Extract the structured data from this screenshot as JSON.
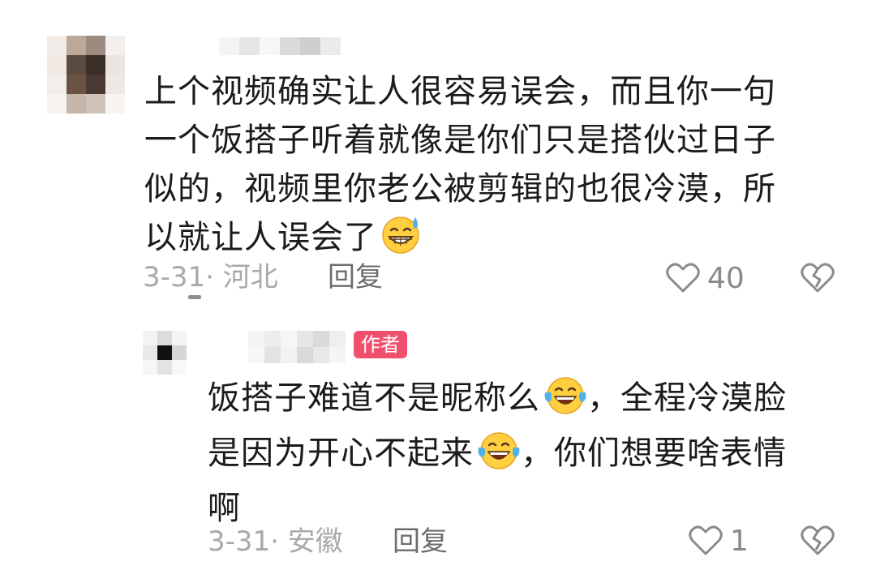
{
  "comments": [
    {
      "text_lines": [
        "上个视频确实让人很容易误会，而且你一句",
        "一个饭搭子听着就像是你们只是搭伙过日子",
        "似的，视频里你老公被剪辑的也很冷漠，所",
        "以就让人误会了"
      ],
      "emoji": "grin-sweat-emoji",
      "date": "3-31",
      "location": "· 河北",
      "reply_label": "回复",
      "like_count": "40",
      "reply": {
        "author_badge": "作者",
        "text_lines": [
          "饭搭子难道不是昵称么",
          "，全程冷漠脸",
          "是因为开心不起来",
          "，你们想要啥表情",
          "啊"
        ],
        "emoji": "tears-of-joy-emoji",
        "date": "3-31",
        "location": "· 安徽",
        "reply_label": "回复",
        "like_count": "1"
      }
    }
  ],
  "colors": {
    "author_badge": "#f0506e",
    "meta_text": "#a9a9a9",
    "reply_text": "#6d6d6d",
    "icon_stroke": "#8a8a8a"
  }
}
